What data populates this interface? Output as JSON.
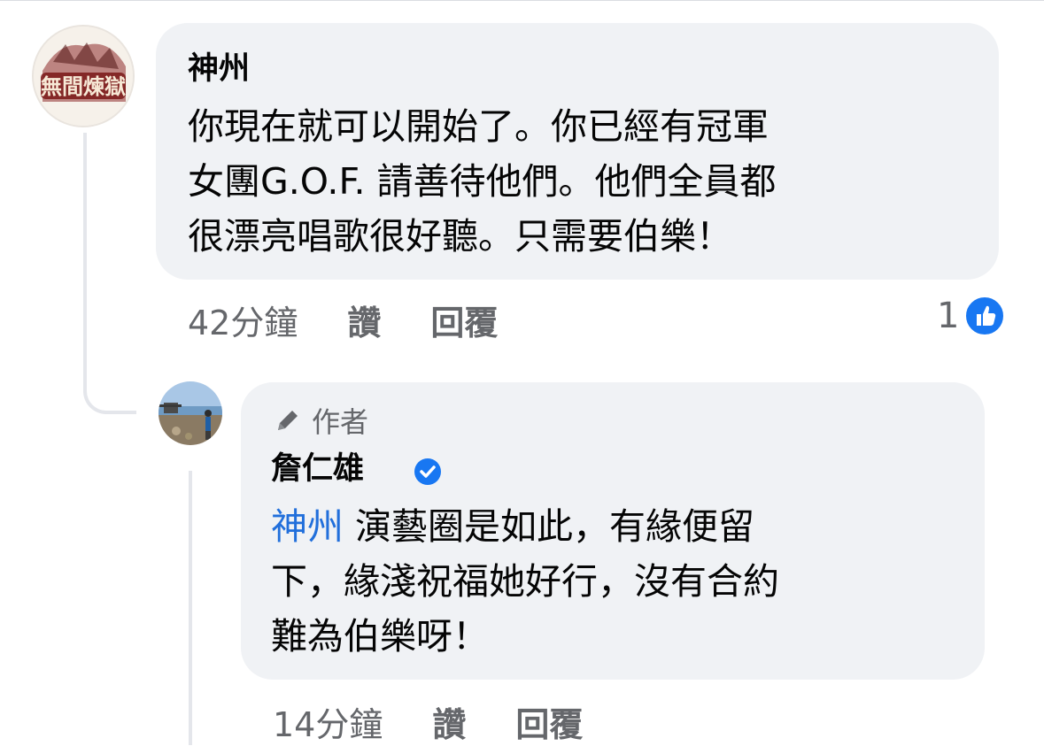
{
  "comment": {
    "author": "神州",
    "text_lines": [
      "你現在就可以開始了。你已經有冠軍",
      "女團G.O.F. 請善待他們。他們全員都",
      "很漂亮唱歌很好聽。只需要伯樂！"
    ],
    "time": "42分鐘",
    "like_label": "讚",
    "reply_label": "回覆",
    "reaction_count": "1",
    "avatar_text": "無間煉獄"
  },
  "reply": {
    "badge_label": "作者",
    "author": "詹仁雄",
    "mention": "神州",
    "text_lines": [
      " 演藝圈是如此，有緣便留",
      "下，緣淺祝福她好行，沒有合約",
      "難為伯樂呀！"
    ],
    "time": "14分鐘",
    "like_label": "讚",
    "reply_label": "回覆"
  },
  "colors": {
    "bubble": "#f0f2f5",
    "text": "#050505",
    "secondary": "#65676b",
    "mention": "#216fdb",
    "like_blue": "#1877f2"
  },
  "icons": {
    "author_badge": "pencil-icon",
    "verified": "verified-check-icon",
    "reaction": "thumbs-up-icon"
  }
}
